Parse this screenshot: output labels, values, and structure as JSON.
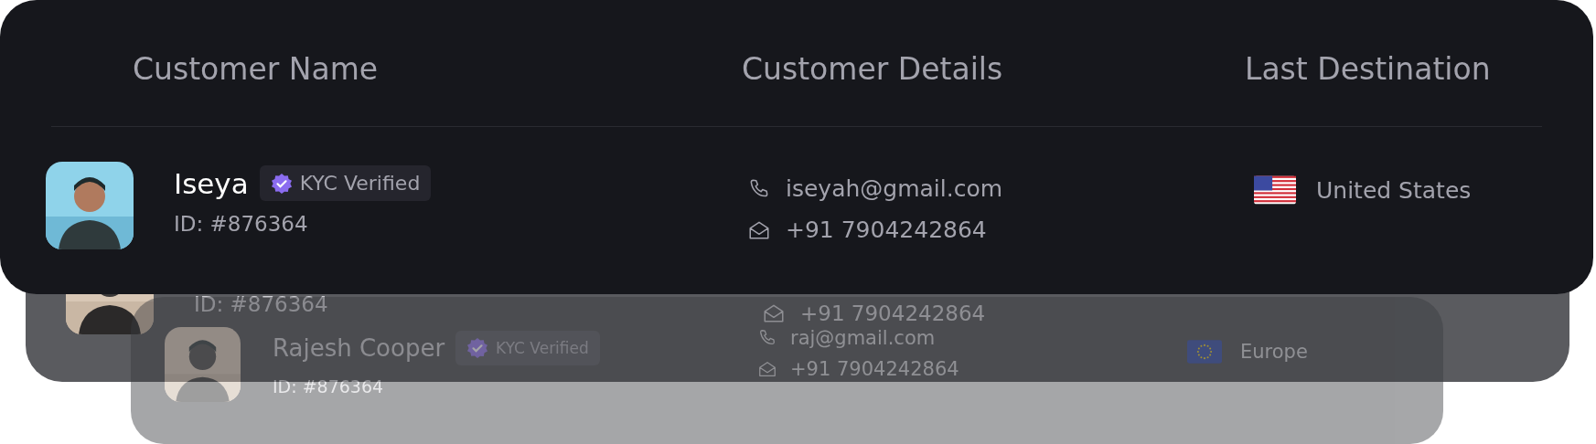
{
  "columns": [
    "Customer Name",
    "Customer Details",
    "Last Destination"
  ],
  "cards": [
    {
      "kind": "front",
      "name": "Iseya",
      "badge": "KYC Verified",
      "id": "ID: #876364",
      "email": "iseyah@gmail.com",
      "phone": "+91 7904242864",
      "destination": "United States",
      "flag": {
        "kind": "us"
      }
    },
    {
      "kind": "middle",
      "id": "ID: #876364",
      "phone": "+91 7904242864"
    },
    {
      "kind": "back",
      "name": "Rajesh Cooper",
      "badge": "KYC Verified",
      "id": "ID: #876364",
      "email": "raj@gmail.com",
      "phone": "+91 7904242864",
      "destination": "Europe",
      "flag": {
        "kind": "eu"
      }
    }
  ]
}
